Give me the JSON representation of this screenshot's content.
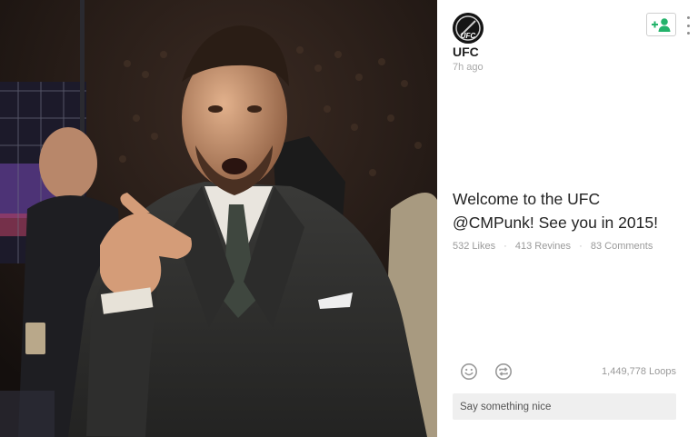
{
  "post": {
    "username": "UFC",
    "timestamp": "7h ago",
    "avatar_text": "UFC",
    "caption_line1": "Welcome to the UFC",
    "caption_line2": "@CMPunk! See you in 2015!",
    "likes": "532 Likes",
    "revines": "413 Revines",
    "comments": "83 Comments",
    "loops": "1,449,778 Loops",
    "separator": "·"
  },
  "comment_input": {
    "placeholder": "Say something nice"
  },
  "icons": {
    "follow": "add-user-icon",
    "more": "more-vertical-icon",
    "like": "smiley-icon",
    "revine": "revine-icon"
  },
  "colors": {
    "accent_green": "#24b36b",
    "text_dark": "#222222",
    "text_muted": "#9a9a9a"
  }
}
